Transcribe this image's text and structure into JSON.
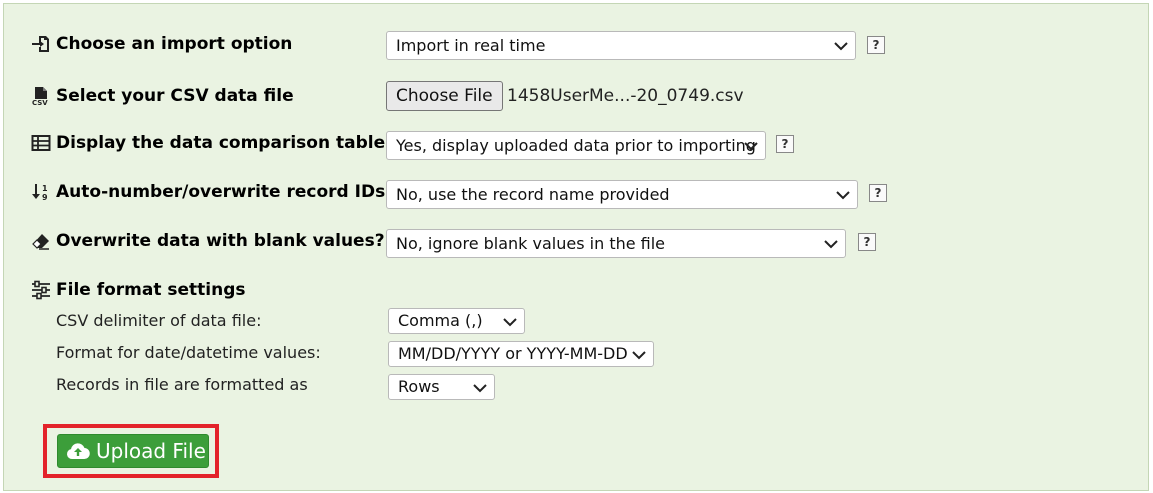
{
  "options": {
    "import_option": {
      "label": "Choose an import option",
      "icon": "file-import-icon",
      "value": "Import in real time",
      "help": "?"
    },
    "csv_file": {
      "label": "Select your CSV data file",
      "icon": "csv-file-icon",
      "button": "Choose File",
      "filename": "1458UserMe...-20_0749.csv"
    },
    "comparison_table": {
      "label": "Display the data comparison table?",
      "icon": "table-icon",
      "value": "Yes, display uploaded data prior to importing",
      "help": "?"
    },
    "auto_number": {
      "label": "Auto-number/overwrite record IDs?",
      "icon": "sort-numeric-icon",
      "value": "No, use the record name provided",
      "help": "?"
    },
    "overwrite_blank": {
      "label": "Overwrite data with blank values?",
      "icon": "eraser-icon",
      "value": "No, ignore blank values in the file",
      "help": "?"
    }
  },
  "format_settings": {
    "title": "File format settings",
    "icon": "sliders-icon",
    "delimiter": {
      "label": "CSV delimiter of data file:",
      "value": "Comma (,)"
    },
    "date_format": {
      "label": "Format for date/datetime values:",
      "value": "MM/DD/YYYY or YYYY-MM-DD"
    },
    "records_format": {
      "label": "Records in file are formatted as",
      "value": "Rows"
    }
  },
  "upload": {
    "label": "Upload File",
    "icon": "cloud-upload-icon",
    "highlight_color": "#e3222a",
    "button_color": "#3c9e3a"
  }
}
